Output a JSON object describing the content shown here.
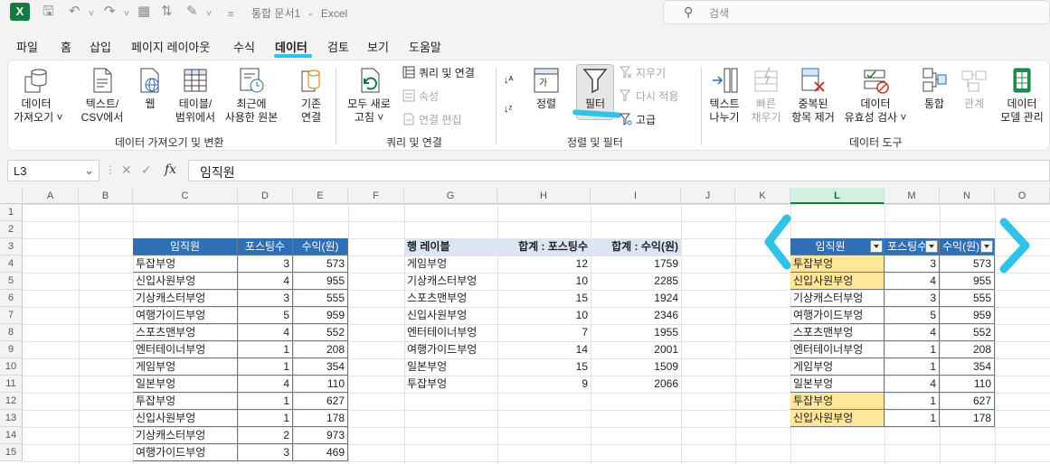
{
  "title": {
    "doc_name": "통합 문서1",
    "app_name": "Excel",
    "separator": "-",
    "search_placeholder": "검색"
  },
  "tabs": [
    "파일",
    "홈",
    "삽입",
    "페이지 레이아웃",
    "수식",
    "데이터",
    "검토",
    "보기",
    "도움말"
  ],
  "ribbon": {
    "get_data": "데이터\n가져오기 ˅",
    "from_csv": "텍스트/\nCSV에서",
    "web": "웹",
    "from_table": "테이블/\n범위에서",
    "recent": "최근에\n사용한 원본",
    "existing": "기존\n연결",
    "group1": "데이터 가져오기 및 변환",
    "refresh_all": "모두 새로\n고침 ˅",
    "queries": "쿼리 및 연결",
    "properties": "속성",
    "edit_links": "연결 편집",
    "group2": "쿼리 및 연결",
    "sort": "정렬",
    "filter": "필터",
    "clear": "지우기",
    "reapply": "다시 적용",
    "advanced": "고급",
    "group3": "정렬 및 필터",
    "text_to_cols": "텍스트\n나누기",
    "flash_fill": "빠른\n채우기",
    "remove_dups": "중복된\n항목 제거",
    "validation": "데이터\n유효성 검사 ˅",
    "consolidate": "통합",
    "relations": "관계",
    "data_model": "데이터\n모델 관리",
    "group4": "데이터 도구"
  },
  "formula_bar": {
    "name_box": "L3",
    "fx": "fx",
    "cancel": "✕",
    "enter": "✓",
    "content": "임직원"
  },
  "columns": [
    "A",
    "B",
    "C",
    "D",
    "E",
    "F",
    "G",
    "H",
    "I",
    "J",
    "K",
    "L",
    "M",
    "N",
    "O"
  ],
  "selected_column": "L",
  "rows": [
    "1",
    "2",
    "3",
    "4",
    "5",
    "6",
    "7",
    "8",
    "9",
    "10",
    "11",
    "12",
    "13",
    "14",
    "15"
  ],
  "table1": {
    "headers": [
      "임직원",
      "포스팅수",
      "수익(원)"
    ],
    "rows": [
      [
        "투잡부엉",
        "3",
        "573"
      ],
      [
        "신입사원부엉",
        "4",
        "955"
      ],
      [
        "기상캐스터부엉",
        "3",
        "555"
      ],
      [
        "여행가이드부엉",
        "5",
        "959"
      ],
      [
        "스포츠맨부엉",
        "4",
        "552"
      ],
      [
        "엔터테이너부엉",
        "1",
        "208"
      ],
      [
        "게임부엉",
        "1",
        "354"
      ],
      [
        "일본부엉",
        "4",
        "110"
      ],
      [
        "투잡부엉",
        "1",
        "627"
      ],
      [
        "신입사원부엉",
        "1",
        "178"
      ],
      [
        "기상캐스터부엉",
        "2",
        "973"
      ],
      [
        "여행가이드부엉",
        "3",
        "469"
      ]
    ]
  },
  "pivot": {
    "headers": [
      "행 레이블",
      "합계 : 포스팅수",
      "합계 : 수익(원)"
    ],
    "rows": [
      [
        "게임부엉",
        "12",
        "1759"
      ],
      [
        "기상캐스터부엉",
        "10",
        "2285"
      ],
      [
        "스포츠맨부엉",
        "15",
        "1924"
      ],
      [
        "신입사원부엉",
        "10",
        "2346"
      ],
      [
        "엔터테이너부엉",
        "7",
        "1955"
      ],
      [
        "여행가이드부엉",
        "14",
        "2001"
      ],
      [
        "일본부엉",
        "15",
        "1509"
      ],
      [
        "투잡부엉",
        "9",
        "2066"
      ]
    ]
  },
  "table2": {
    "headers": [
      "임직원",
      "포스팅수",
      "수익(원)"
    ],
    "rows": [
      [
        "투잡부엉",
        "3",
        "573"
      ],
      [
        "신입사원부엉",
        "4",
        "955"
      ],
      [
        "기상캐스터부엉",
        "3",
        "555"
      ],
      [
        "여행가이드부엉",
        "5",
        "959"
      ],
      [
        "스포츠맨부엉",
        "4",
        "552"
      ],
      [
        "엔터테이너부엉",
        "1",
        "208"
      ],
      [
        "게임부엉",
        "1",
        "354"
      ],
      [
        "일본부엉",
        "4",
        "110"
      ],
      [
        "투잡부엉",
        "1",
        "627"
      ],
      [
        "신입사원부엉",
        "1",
        "178"
      ]
    ],
    "highlighted_rows": [
      0,
      1,
      8,
      9
    ],
    "highlight_color": "#ffe699",
    "header_color": "#2f6fb5"
  },
  "accent_color": "#107c41",
  "annotation_color": "#31c3e6"
}
